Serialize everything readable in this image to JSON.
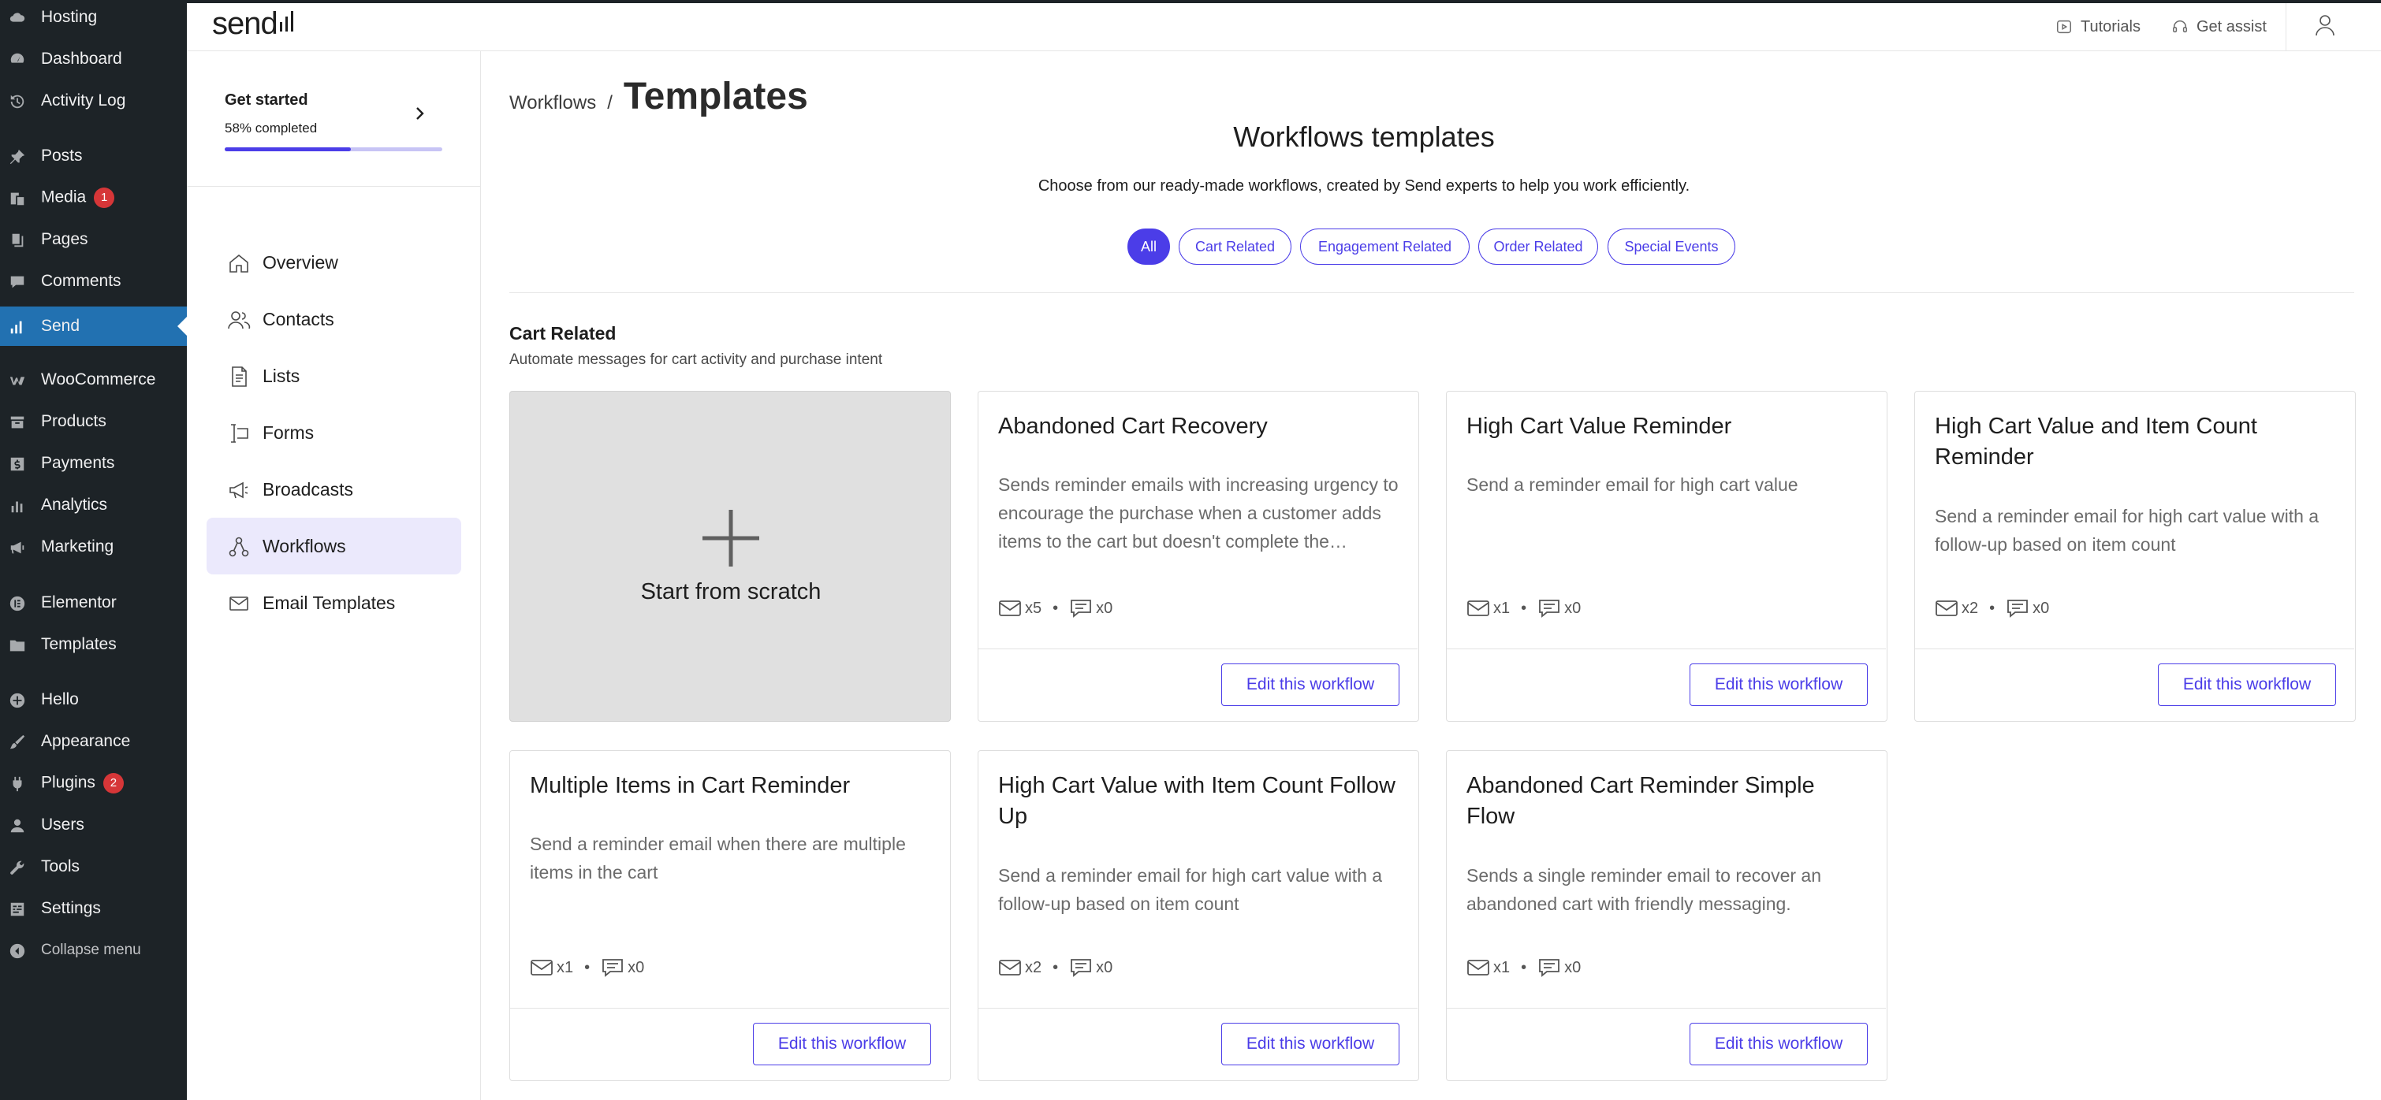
{
  "wp_menu": [
    {
      "label": "Hosting",
      "icon": "cloud-icon"
    },
    {
      "label": "Dashboard",
      "icon": "dashboard-icon"
    },
    {
      "label": "Activity Log",
      "icon": "history-icon"
    },
    {
      "label": "Posts",
      "icon": "pin-icon"
    },
    {
      "label": "Media",
      "icon": "media-icon",
      "badge": "1"
    },
    {
      "label": "Pages",
      "icon": "pages-icon"
    },
    {
      "label": "Comments",
      "icon": "comment-icon"
    },
    {
      "label": "Send",
      "icon": "send-icon",
      "active": true
    },
    {
      "label": "WooCommerce",
      "icon": "woocommerce-icon"
    },
    {
      "label": "Products",
      "icon": "archive-icon"
    },
    {
      "label": "Payments",
      "icon": "dollar-icon"
    },
    {
      "label": "Analytics",
      "icon": "bar-chart-icon"
    },
    {
      "label": "Marketing",
      "icon": "megaphone-icon"
    },
    {
      "label": "Elementor",
      "icon": "elementor-icon"
    },
    {
      "label": "Templates",
      "icon": "folder-icon"
    },
    {
      "label": "Hello",
      "icon": "plus-circle-icon"
    },
    {
      "label": "Appearance",
      "icon": "brush-icon"
    },
    {
      "label": "Plugins",
      "icon": "plug-icon",
      "badge": "2"
    },
    {
      "label": "Users",
      "icon": "user-icon"
    },
    {
      "label": "Tools",
      "icon": "wrench-icon"
    },
    {
      "label": "Settings",
      "icon": "settings-icon"
    },
    {
      "label": "Collapse menu",
      "icon": "collapse-icon"
    }
  ],
  "topbar": {
    "logo": "send",
    "tutorials": "Tutorials",
    "get_assist": "Get assist"
  },
  "get_started": {
    "title": "Get started",
    "progress_label": "58% completed",
    "progress_fraction": 0.58
  },
  "send_nav": [
    {
      "label": "Overview",
      "icon": "home-icon"
    },
    {
      "label": "Contacts",
      "icon": "contacts-icon"
    },
    {
      "label": "Lists",
      "icon": "list-doc-icon"
    },
    {
      "label": "Forms",
      "icon": "form-icon"
    },
    {
      "label": "Broadcasts",
      "icon": "megaphone-icon"
    },
    {
      "label": "Workflows",
      "icon": "workflow-icon",
      "active": true
    },
    {
      "label": "Email Templates",
      "icon": "mail-icon"
    }
  ],
  "breadcrumb": {
    "parent": "Workflows",
    "separator": "/",
    "current": "Templates"
  },
  "section": {
    "title": "Workflows templates",
    "subtitle": "Choose from our ready-made workflows, created by Send experts to help you work efficiently."
  },
  "filters": [
    {
      "label": "All",
      "active": true
    },
    {
      "label": "Cart Related"
    },
    {
      "label": "Engagement Related"
    },
    {
      "label": "Order Related"
    },
    {
      "label": "Special Events"
    }
  ],
  "category": {
    "title": "Cart Related",
    "subtitle": "Automate messages for cart activity and purchase intent"
  },
  "scratch_label": "Start from scratch",
  "edit_label": "Edit this workflow",
  "templates": [
    {
      "title": "Abandoned Cart Recovery",
      "description": "Sends reminder emails with increasing urgency to encourage the purchase when a customer adds items to the cart but doesn't complete the checkout.",
      "emails": "x5",
      "sms": "x0"
    },
    {
      "title": "High Cart Value Reminder",
      "description": "Send a reminder email for high cart value",
      "emails": "x1",
      "sms": "x0"
    },
    {
      "title": "High Cart Value and Item Count Reminder",
      "description": "Send a reminder email for high cart value with a follow-up based on item count",
      "emails": "x2",
      "sms": "x0"
    },
    {
      "title": "Multiple Items in Cart Reminder",
      "description": "Send a reminder email when there are multiple items in the cart",
      "emails": "x1",
      "sms": "x0"
    },
    {
      "title": "High Cart Value with Item Count Follow Up",
      "description": "Send a reminder email for high cart value with a follow-up based on item count",
      "emails": "x2",
      "sms": "x0"
    },
    {
      "title": "Abandoned Cart Reminder Simple Flow",
      "description": "Sends a single reminder email to recover an abandoned cart with friendly messaging.",
      "emails": "x1",
      "sms": "x0"
    }
  ],
  "colors": {
    "accent": "#4b3de8",
    "wp_sidebar": "#1d2327",
    "wp_active": "#2271b1",
    "nav_active_bg": "#ebe9fc"
  }
}
